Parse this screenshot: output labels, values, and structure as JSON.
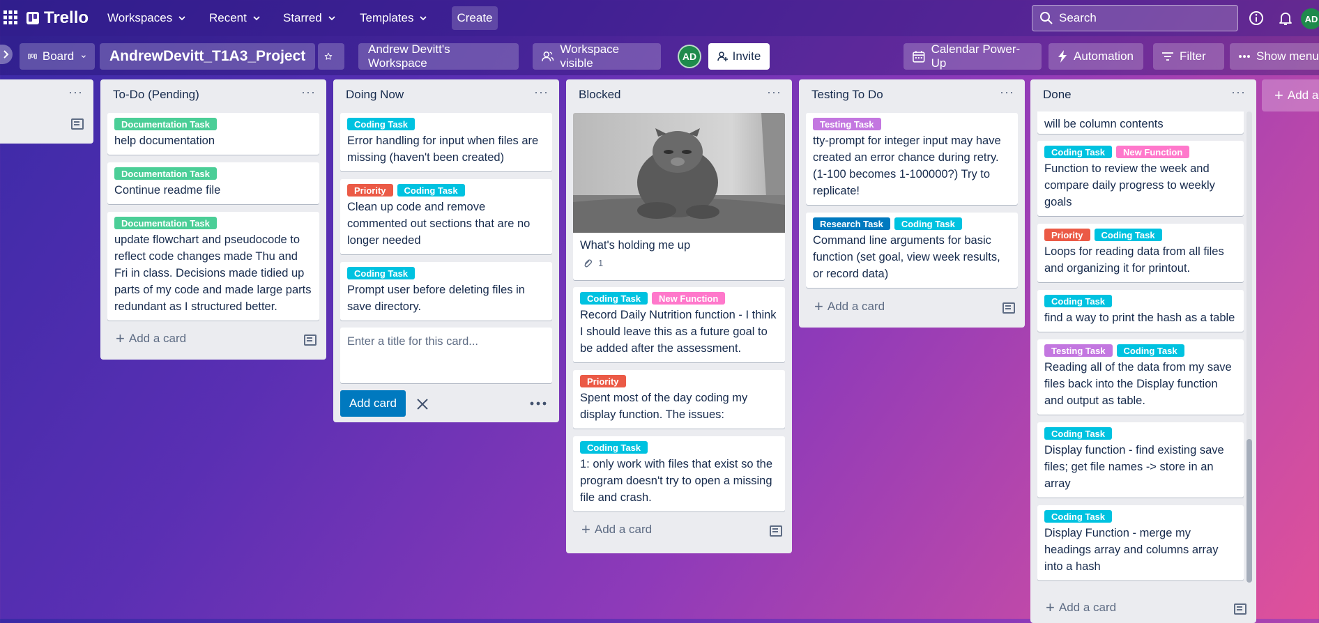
{
  "topbar": {
    "logo": "Trello",
    "nav": {
      "workspaces": "Workspaces",
      "recent": "Recent",
      "starred": "Starred",
      "templates": "Templates",
      "create": "Create"
    },
    "search_placeholder": "Search",
    "user_initials": "AD"
  },
  "boardbar": {
    "view": "Board",
    "title": "AndrewDevitt_T1A3_Project",
    "workspace": "Andrew Devitt's Workspace",
    "visibility": "Workspace visible",
    "member_initials": "AD",
    "invite": "Invite",
    "calendar": "Calendar Power-Up",
    "automation": "Automation",
    "filter": "Filter",
    "show_menu": "Show menu"
  },
  "colors": {
    "Documentation Task": "#4bce97",
    "Coding Task": "#00c2e0",
    "Priority": "#eb5a46",
    "New Function": "#ff78cb",
    "Testing Task": "#c377e0",
    "Research Task": "#0079bf"
  },
  "lists": [
    {
      "title": "To-Do (Pending)",
      "add_card": "Add a card",
      "cards": [
        {
          "labels": [
            "Documentation Task"
          ],
          "text": "help documentation"
        },
        {
          "labels": [
            "Documentation Task"
          ],
          "text": "Continue readme file"
        },
        {
          "labels": [
            "Documentation Task"
          ],
          "text": "update flowchart and pseudocode to reflect code changes made Thu and Fri in class. Decisions made tidied up parts of my code and made large parts redundant as I structured better."
        }
      ]
    },
    {
      "title": "Doing Now",
      "cards": [
        {
          "labels": [
            "Coding Task"
          ],
          "text": "Error handling for input when files are missing (haven't been created)"
        },
        {
          "labels": [
            "Priority",
            "Coding Task"
          ],
          "text": "Clean up code and remove commented out sections that are no longer needed"
        },
        {
          "labels": [
            "Coding Task"
          ],
          "text": "Prompt user before deleting files in save directory."
        }
      ],
      "composer_placeholder": "Enter a title for this card...",
      "add_button": "Add card"
    },
    {
      "title": "Blocked",
      "add_card": "Add a card",
      "cards": [
        {
          "labels": [],
          "text": "What's holding me up",
          "attachments": "1",
          "cover": "cat-image"
        },
        {
          "labels": [
            "Coding Task",
            "New Function"
          ],
          "text": "Record Daily Nutrition function - I think I should leave this as a future goal to be added after the assessment."
        },
        {
          "labels": [
            "Priority"
          ],
          "text": "Spent most of the day coding my display function. The issues:"
        },
        {
          "labels": [
            "Coding Task"
          ],
          "text": "1: only work with files that exist so the program doesn't try to open a missing file and crash."
        }
      ]
    },
    {
      "title": "Testing To Do",
      "add_card": "Add a card",
      "cards": [
        {
          "labels": [
            "Testing Task"
          ],
          "text": "tty-prompt for integer input may have created an error chance during retry. (1-100 becomes 1-100000?) Try to replicate!"
        },
        {
          "labels": [
            "Research Task",
            "Coding Task"
          ],
          "text": "Command line arguments for basic function (set goal, view week results, or record data)"
        }
      ]
    },
    {
      "title": "Done",
      "add_card": "Add a card",
      "cards": [
        {
          "labels": [],
          "text": "will be column contents"
        },
        {
          "labels": [
            "Coding Task",
            "New Function"
          ],
          "text": "Function to review the week and compare daily progress to weekly goals"
        },
        {
          "labels": [
            "Priority",
            "Coding Task"
          ],
          "text": "Loops for reading data from all files and organizing it for printout."
        },
        {
          "labels": [
            "Coding Task"
          ],
          "text": "find a way to print the hash as a table"
        },
        {
          "labels": [
            "Testing Task",
            "Coding Task"
          ],
          "text": "Reading all of the data from my save files back into the Display function and output as table."
        },
        {
          "labels": [
            "Coding Task"
          ],
          "text": "Display function - find existing save files; get file names -> store in an array"
        },
        {
          "labels": [
            "Coding Task"
          ],
          "text": "Display Function - merge my headings array and columns array into a hash"
        }
      ]
    }
  ],
  "add_list": "Add a"
}
